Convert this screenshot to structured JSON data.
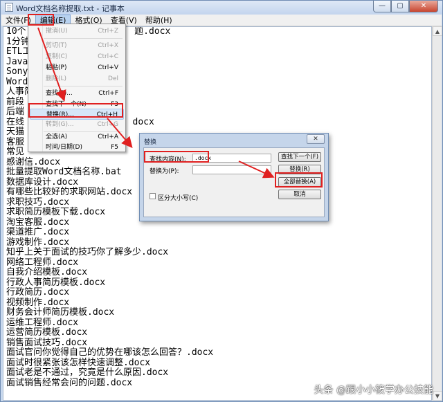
{
  "window": {
    "title": "Word文档名称提取.txt - 记事本",
    "minimize": "—",
    "maximize": "▢",
    "close": "✕"
  },
  "menubar": {
    "file": "文件(F)",
    "edit": "编辑(E)",
    "format": "格式(O)",
    "view": "查看(V)",
    "help": "帮助(H)"
  },
  "editor": {
    "lines": [
      "10个                    题.docx",
      "1分钟",
      "ETL工",
      "Java",
      "Sony",
      "Word",
      "人事简",
      "前段",
      "后端",
      "在线                    docx",
      "天猫",
      "客服",
      "常见",
      "感谢信.docx",
      "批量提取Word文档名称.bat",
      "数据库设计.docx",
      "有哪些比较好的求职网站.docx",
      "求职技巧.docx",
      "求职简历模板下载.docx",
      "淘宝客服.docx",
      "渠道推广.docx",
      "游戏制作.docx",
      "知乎上关于面试的技巧你了解多少.docx",
      "网络工程师.docx",
      "自我介绍模板.docx",
      "行政人事简历模板.docx",
      "行政简历.docx",
      "视频制作.docx",
      "财务会计师简历模板.docx",
      "运维工程师.docx",
      "运营简历模板.docx",
      "销售面试技巧.docx",
      "面试官问你觉得自己的优势在哪该怎么回答？.docx",
      "面试时很紧张该怎样快速调整.docx",
      "面试老是不通过，究竟是什么原因.docx",
      "面试销售经常会问的问题.docx"
    ]
  },
  "edit_menu": {
    "undo": {
      "label": "撤消(U)",
      "key": "Ctrl+Z"
    },
    "cut": {
      "label": "剪切(T)",
      "key": "Ctrl+X"
    },
    "copy": {
      "label": "复制(C)",
      "key": "Ctrl+C"
    },
    "paste": {
      "label": "粘贴(P)",
      "key": "Ctrl+V"
    },
    "delete": {
      "label": "删除(L)",
      "key": "Del"
    },
    "find": {
      "label": "查找(F)...",
      "key": "Ctrl+F"
    },
    "find_next": {
      "label": "查找下一个(N)",
      "key": "F3"
    },
    "replace": {
      "label": "替换(R)...",
      "key": "Ctrl+H"
    },
    "goto": {
      "label": "转到(G)...",
      "key": "Ctrl+G"
    },
    "select_all": {
      "label": "全选(A)",
      "key": "Ctrl+A"
    },
    "time_date": {
      "label": "时间/日期(D)",
      "key": "F5"
    }
  },
  "replace_dialog": {
    "title": "替换",
    "find_label": "查找内容(N):",
    "find_value": ".docx",
    "replace_label": "替换为(P):",
    "replace_value": "",
    "match_case_label": "区分大小写(C)",
    "find_next_button": "查找下一个(F)",
    "replace_button": "替换(R)",
    "replace_all_button": "全部替换(A)",
    "cancel_button": "取消",
    "close": "✕"
  },
  "watermark": "头条 @跟小小筱学办公技能",
  "colors": {
    "annotation_red": "#e02020",
    "menu_highlight": "#d6e6f8"
  }
}
